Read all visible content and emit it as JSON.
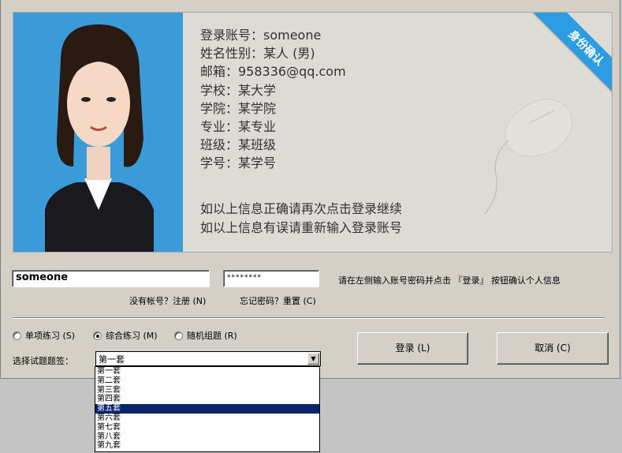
{
  "ribbon": "身份确认",
  "info": {
    "lines": [
      "登录账号：someone",
      "姓名性别：某人 (男)",
      "邮箱：958336@qq.com",
      "学校：某大学",
      "学院：某学院",
      "专业：某专业",
      "班级：某班级",
      "学号：某学号"
    ],
    "confirm": [
      "如以上信息正确请再次点击登录继续",
      "如以上信息有误请重新输入登录账号"
    ]
  },
  "login": {
    "username": "someone",
    "password": "********",
    "hint": "请在左侧输入账号密码并点击 『登录』 按钮确认个人信息",
    "register": "没有帐号？注册 (N)",
    "forgot": "忘记密码？重置 (C)"
  },
  "mode": {
    "options": [
      {
        "label": "单项练习 (S)",
        "checked": false
      },
      {
        "label": "综合练习 (M)",
        "checked": true
      },
      {
        "label": "随机组题 (R)",
        "checked": false
      }
    ]
  },
  "set_select": {
    "label": "选择试题题签：",
    "value": "第一套",
    "options": [
      "第一套",
      "第二套",
      "第三套",
      "第四套",
      "第五套",
      "第六套",
      "第七套",
      "第八套",
      "第九套"
    ],
    "highlighted": 4
  },
  "buttons": {
    "login": "登录 (L)",
    "cancel": "取消 (C)"
  },
  "colors": {
    "ribbon": "#2d9de3",
    "photo_bg": "#3b9ad8",
    "selection": "#0a246a"
  }
}
